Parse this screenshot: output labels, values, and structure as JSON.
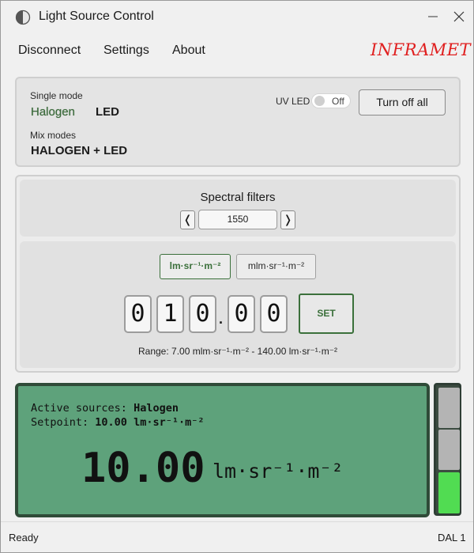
{
  "window": {
    "title": "Light Source Control",
    "icon": "half-circle-icon"
  },
  "menu": {
    "items": [
      "Disconnect",
      "Settings",
      "About"
    ],
    "brand": "INFRAMET"
  },
  "modes": {
    "single_label": "Single mode",
    "single_options": [
      "Halogen",
      "LED"
    ],
    "selected": "Halogen",
    "mix_label": "Mix modes",
    "mix_option": "HALOGEN + LED",
    "uv_label": "UV LED",
    "uv_state": "Off",
    "turn_off_label": "Turn off all"
  },
  "filters": {
    "title": "Spectral filters",
    "prev": "❬",
    "next": "❭",
    "value": "1550"
  },
  "setpoint": {
    "units": [
      "lm·sr⁻¹·m⁻²",
      "mlm·sr⁻¹·m⁻²"
    ],
    "selected_unit": "lm·sr⁻¹·m⁻²",
    "digits": [
      "0",
      "1",
      "0",
      "0",
      "0"
    ],
    "decimal": ".",
    "set_label": "SET",
    "range": "Range: 7.00 mlm·sr⁻¹·m⁻² - 140.00 lm·sr⁻¹·m⁻²"
  },
  "display": {
    "active_label": "Active sources:",
    "active_value": "Halogen",
    "setpoint_label": "Setpoint:",
    "setpoint_value": "10.00 lm·sr⁻¹·m⁻²",
    "big_value": "10.00",
    "big_unit": "lm·sr⁻¹·m⁻²",
    "background": "#5ea27b"
  },
  "meter": {
    "segments_total": 3,
    "segments_lit": 1,
    "lit_color": "#51dc52"
  },
  "status": {
    "left": "Ready",
    "right": "DAL 1"
  }
}
